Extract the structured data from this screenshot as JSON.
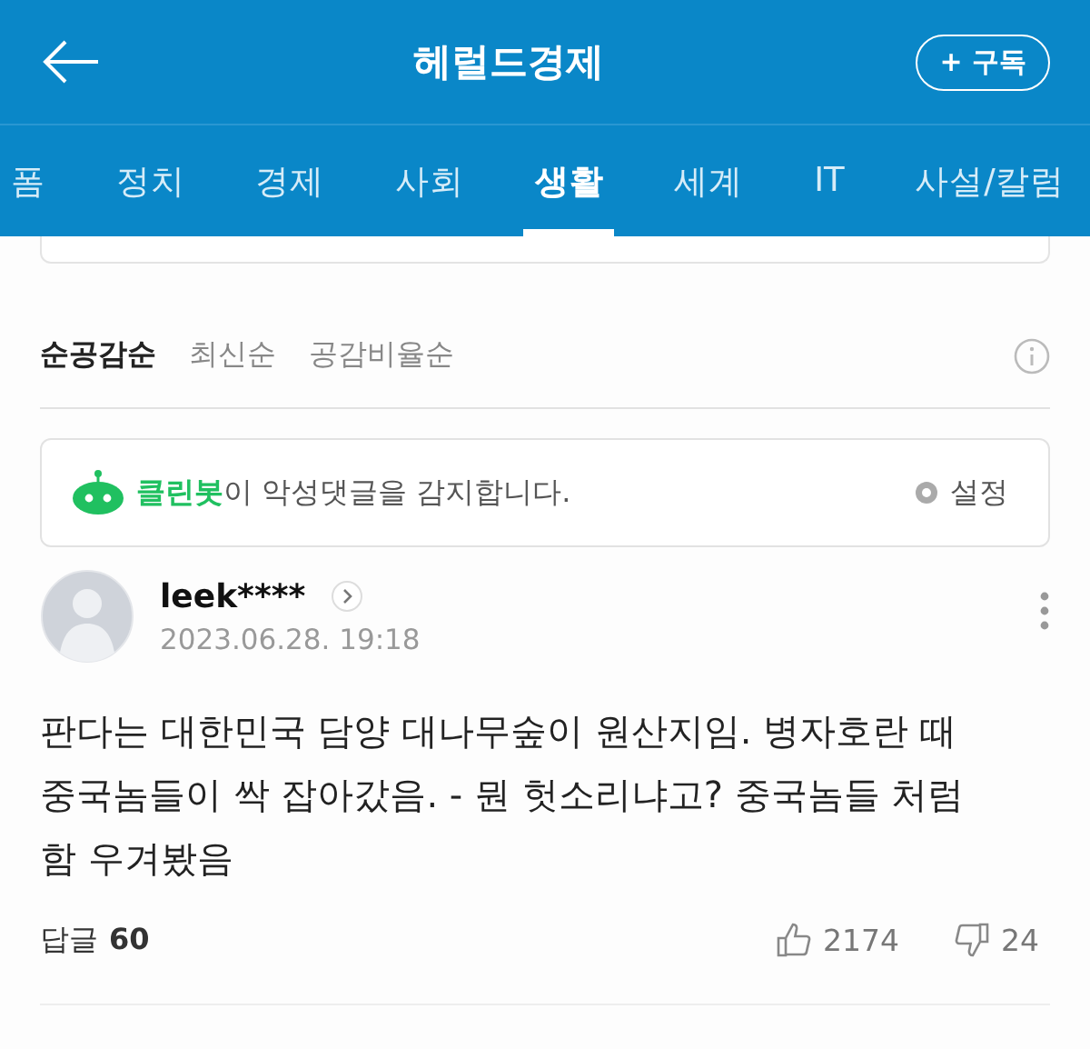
{
  "header": {
    "title": "헤럴드경제",
    "subscribe": "+ 구독"
  },
  "tabs": [
    {
      "label": "폼",
      "selected": false
    },
    {
      "label": "정치",
      "selected": false
    },
    {
      "label": "경제",
      "selected": false
    },
    {
      "label": "사회",
      "selected": false
    },
    {
      "label": "생활",
      "selected": true
    },
    {
      "label": "세계",
      "selected": false
    },
    {
      "label": "IT",
      "selected": false
    },
    {
      "label": "사설/칼럼",
      "selected": false
    }
  ],
  "sort_options": [
    {
      "label": "순공감순",
      "selected": true
    },
    {
      "label": "최신순",
      "selected": false
    },
    {
      "label": "공감비율순",
      "selected": false
    }
  ],
  "cleanbot": {
    "message": "**클린봇**이 악성댓글을 감지합니다.",
    "settings": "설정"
  },
  "comment": {
    "user": "leek****",
    "date": "2023.06.28. 19:18",
    "body": "판다는 대한민국 담양 대나무숲이 원산지임. 병자호란 때 중국놈들이 싹 잡아갔음. - 뭔 헛소리냐고? 중국놈들 처럼 함 우겨봤음",
    "replies_label": "답글",
    "replies": "60",
    "likes": "2174",
    "dislikes": "24"
  }
}
